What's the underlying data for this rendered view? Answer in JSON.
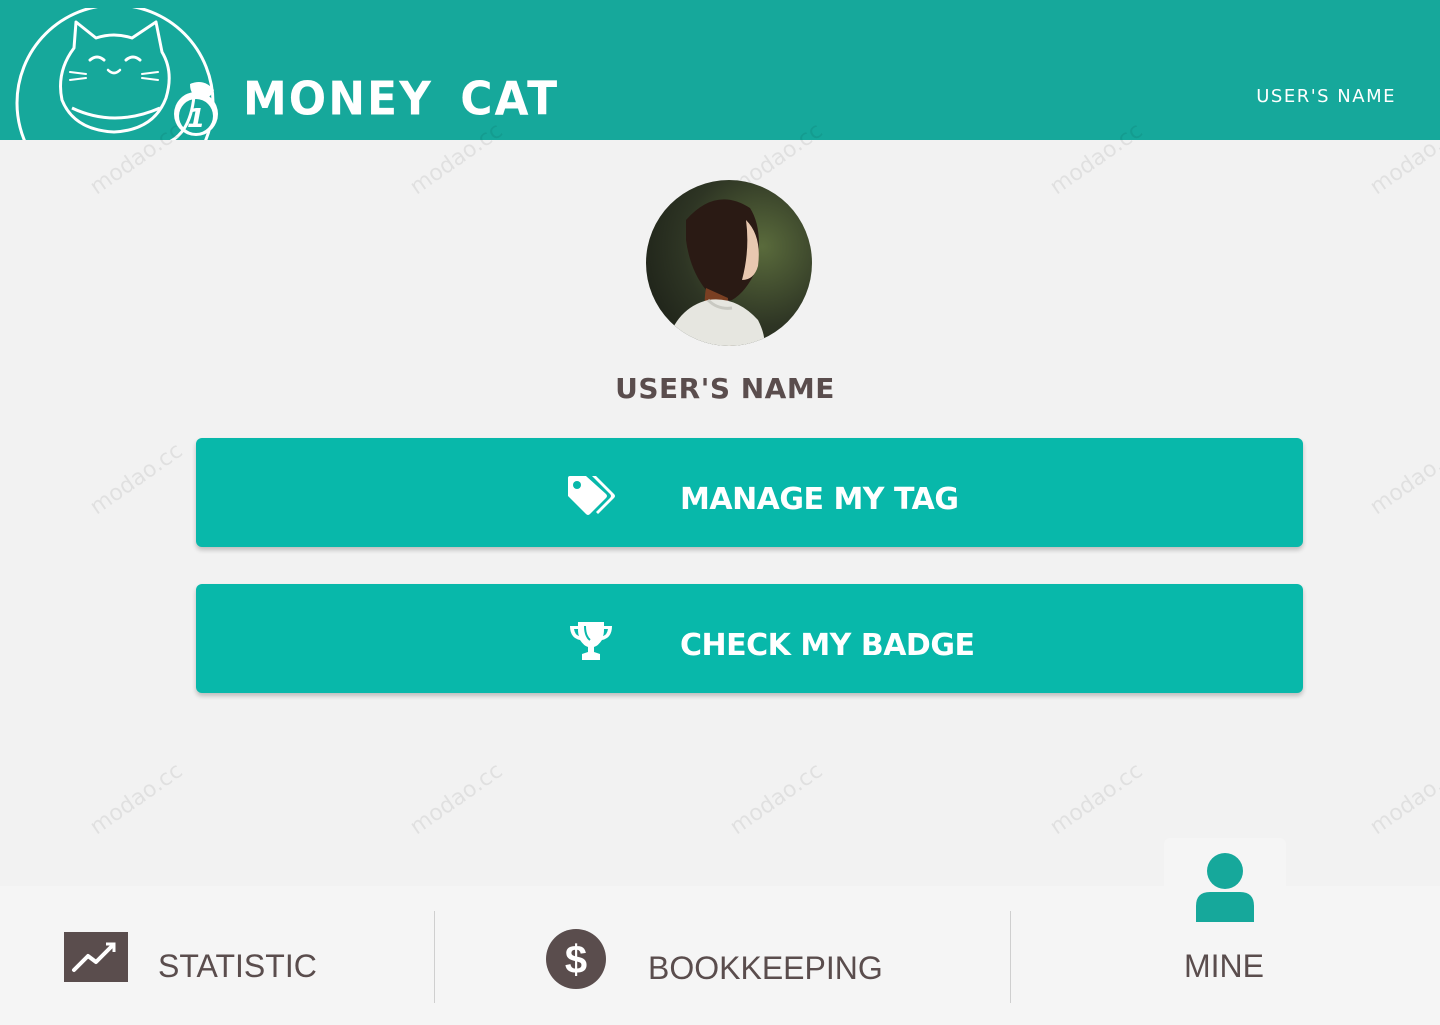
{
  "header": {
    "app_title": "MONEY CAT",
    "user_name": "USER'S NAME",
    "logo_badge": "1"
  },
  "profile": {
    "name": "USER'S NAME"
  },
  "actions": [
    {
      "label": "MANAGE MY TAG",
      "icon": "tags-icon"
    },
    {
      "label": "CHECK MY BADGE",
      "icon": "trophy-icon"
    }
  ],
  "bottom_nav": {
    "items": [
      {
        "label": "STATISTIC",
        "icon": "chart-line-icon"
      },
      {
        "label": "BOOKKEEPING",
        "icon": "dollar-icon"
      },
      {
        "label": "MINE",
        "icon": "user-icon",
        "active": true
      }
    ]
  },
  "watermark": "modao.cc",
  "colors": {
    "header_bg": "#16a89b",
    "button_bg": "#08b8aa",
    "page_bg": "#f2f2f2",
    "text_dark": "#5a4d4d",
    "active_icon": "#16a89b"
  }
}
